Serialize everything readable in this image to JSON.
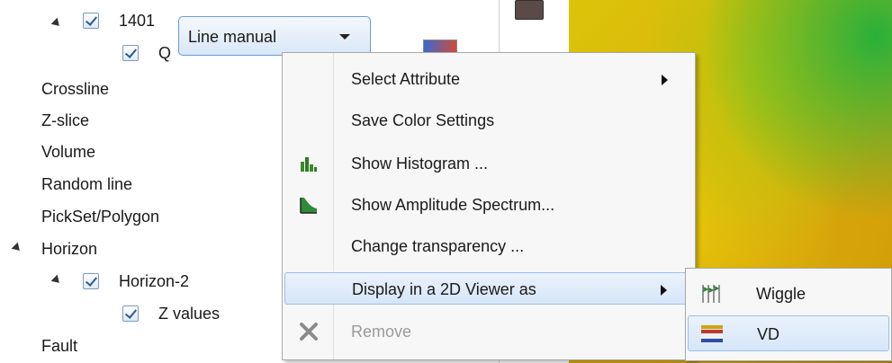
{
  "tree": {
    "node_1401": "1401",
    "node_q": "Q",
    "crossline": "Crossline",
    "zslice": "Z-slice",
    "volume": "Volume",
    "random_line": "Random line",
    "pickset": "PickSet/Polygon",
    "horizon": "Horizon",
    "horizon2": "Horizon-2",
    "zvalues": "Z values",
    "fault": "Fault"
  },
  "combo": {
    "value": "Line manual"
  },
  "menu": {
    "items": [
      {
        "label": "Select Attribute",
        "icon": "",
        "submenu": true
      },
      {
        "label": "Save Color Settings",
        "icon": ""
      },
      {
        "label": "Show Histogram ...",
        "icon": "histogram-icon"
      },
      {
        "label": "Show Amplitude Spectrum...",
        "icon": "spectrum-icon"
      },
      {
        "label": "Change transparency ...",
        "icon": ""
      },
      {
        "label": "Display in a 2D Viewer as",
        "icon": "",
        "submenu": true,
        "highlighted": true
      },
      {
        "label": "Remove",
        "icon": "remove-icon",
        "disabled": true
      }
    ]
  },
  "submenu": {
    "items": [
      {
        "label": "Wiggle",
        "icon": "wiggle-icon"
      },
      {
        "label": "VD",
        "icon": "vd-icon",
        "highlighted": true
      }
    ]
  },
  "colors": {
    "highlight": "#d6e6f8",
    "menu_bg": "#f7f7f7",
    "disabled_text": "#9a9a9a"
  }
}
